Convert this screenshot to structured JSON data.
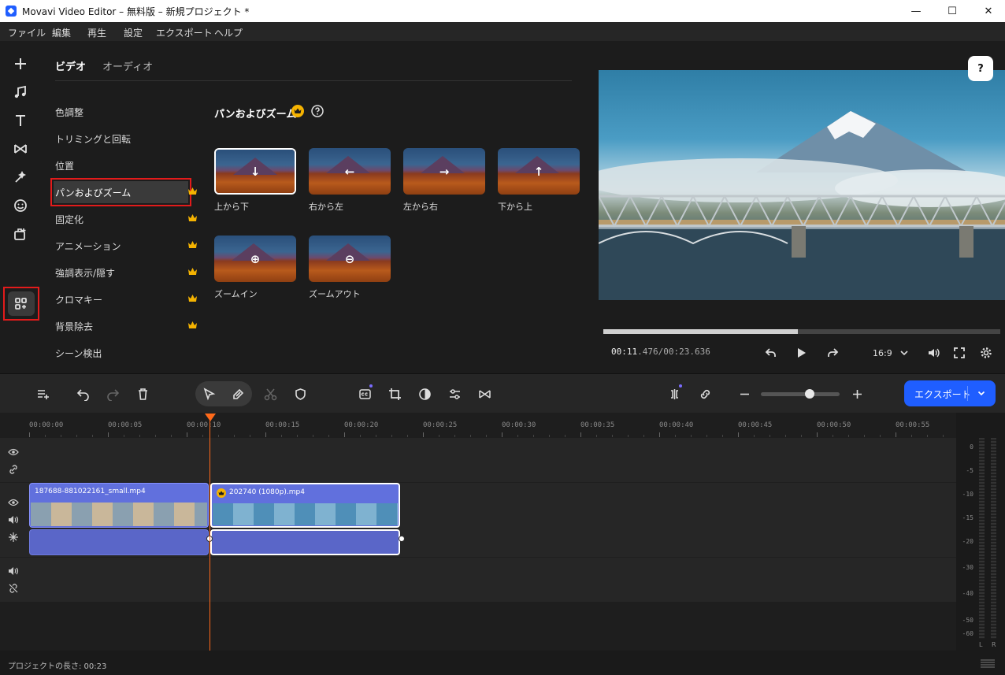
{
  "window": {
    "title": "Movavi Video Editor – 無料版 – 新規プロジェクト *",
    "minimize": "—",
    "maximize": "☐",
    "close": "✕"
  },
  "menu": [
    "ファイル",
    "編集",
    "再生",
    "設定",
    "エクスポート",
    "ヘルプ"
  ],
  "sidebar_icons": [
    "add-icon",
    "music-icon",
    "text-icon",
    "transitions-icon",
    "effects-icon",
    "stickers-icon",
    "elements-icon",
    "more-tools-icon"
  ],
  "panel": {
    "tabs": [
      "ビデオ",
      "オーディオ"
    ],
    "active_tab": "ビデオ",
    "categories": [
      {
        "label": "色調整",
        "premium": false
      },
      {
        "label": "トリミングと回転",
        "premium": false
      },
      {
        "label": "位置",
        "premium": false
      },
      {
        "label": "パンおよびズーム",
        "premium": true
      },
      {
        "label": "固定化",
        "premium": true
      },
      {
        "label": "アニメーション",
        "premium": true
      },
      {
        "label": "強調表示/隠す",
        "premium": true
      },
      {
        "label": "クロマキー",
        "premium": true
      },
      {
        "label": "背景除去",
        "premium": true
      },
      {
        "label": "シーン検出",
        "premium": false
      }
    ],
    "selected_category": "パンおよびズーム",
    "section_title": "パンおよびズーム",
    "presets": [
      {
        "label": "上から下",
        "glyph": "↓",
        "selected": true
      },
      {
        "label": "右から左",
        "glyph": "←",
        "selected": false
      },
      {
        "label": "左から右",
        "glyph": "→",
        "selected": false
      },
      {
        "label": "下から上",
        "glyph": "↑",
        "selected": false
      },
      {
        "label": "ズームイン",
        "glyph": "⊕",
        "selected": false
      },
      {
        "label": "ズームアウト",
        "glyph": "⊖",
        "selected": false
      }
    ]
  },
  "player": {
    "help": "?",
    "time_current_main": "00:11",
    "time_current_ms": ".476",
    "time_total": "/00:23.636",
    "progress": 0.49,
    "aspect": "16:9"
  },
  "toolbar": {
    "export_label": "エクスポート"
  },
  "timeline": {
    "ruler": [
      "00:00:00",
      "00:00:05",
      "00:00:10",
      "00:00:15",
      "00:00:20",
      "00:00:25",
      "00:00:30",
      "00:00:35",
      "00:00:40",
      "00:00:45",
      "00:00:50",
      "00:00:55"
    ],
    "clips": [
      {
        "name": "187688-881022161_small.mp4"
      },
      {
        "name": "202740 (1080p).mp4"
      }
    ],
    "meter_labels": [
      "0",
      "-5",
      "-10",
      "-15",
      "-20",
      "-30",
      "-40",
      "-50",
      "-60"
    ],
    "meter_channels": [
      "L",
      "R"
    ]
  },
  "status": {
    "project_length": "プロジェクトの長さ: 00:23"
  },
  "colors": {
    "accent": "#1f5eff",
    "highlight_border": "#e21b1b",
    "playhead": "#ff6a1a",
    "clip": "#5f6fd8",
    "crown": "#f5b301"
  }
}
